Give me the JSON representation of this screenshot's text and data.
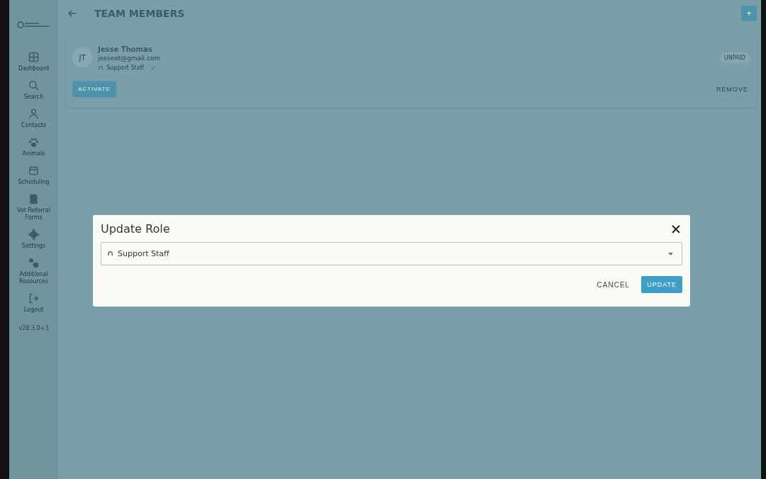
{
  "sidebar": {
    "items": [
      {
        "label": "Dashboard"
      },
      {
        "label": "Search"
      },
      {
        "label": "Contacts"
      },
      {
        "label": "Animals"
      },
      {
        "label": "Scheduling"
      },
      {
        "label": "Vet Referral Forms"
      },
      {
        "label": "Settings"
      },
      {
        "label": "Additional Resources"
      },
      {
        "label": "Logout"
      }
    ],
    "version": "v28.3.0+3"
  },
  "header": {
    "title": "TEAM MEMBERS",
    "add_button": "+"
  },
  "member": {
    "initials": "JT",
    "name": "Jesse Thomas",
    "email": "jesseet@gmail.com",
    "role": "Support Staff",
    "status": "UNPAID",
    "activate_button": "ACTIVATE",
    "remove_button": "REMOVE"
  },
  "dialog": {
    "title": "Update Role",
    "role_value": "Support Staff",
    "cancel_button": "CANCEL",
    "update_button": "UPDATE"
  }
}
